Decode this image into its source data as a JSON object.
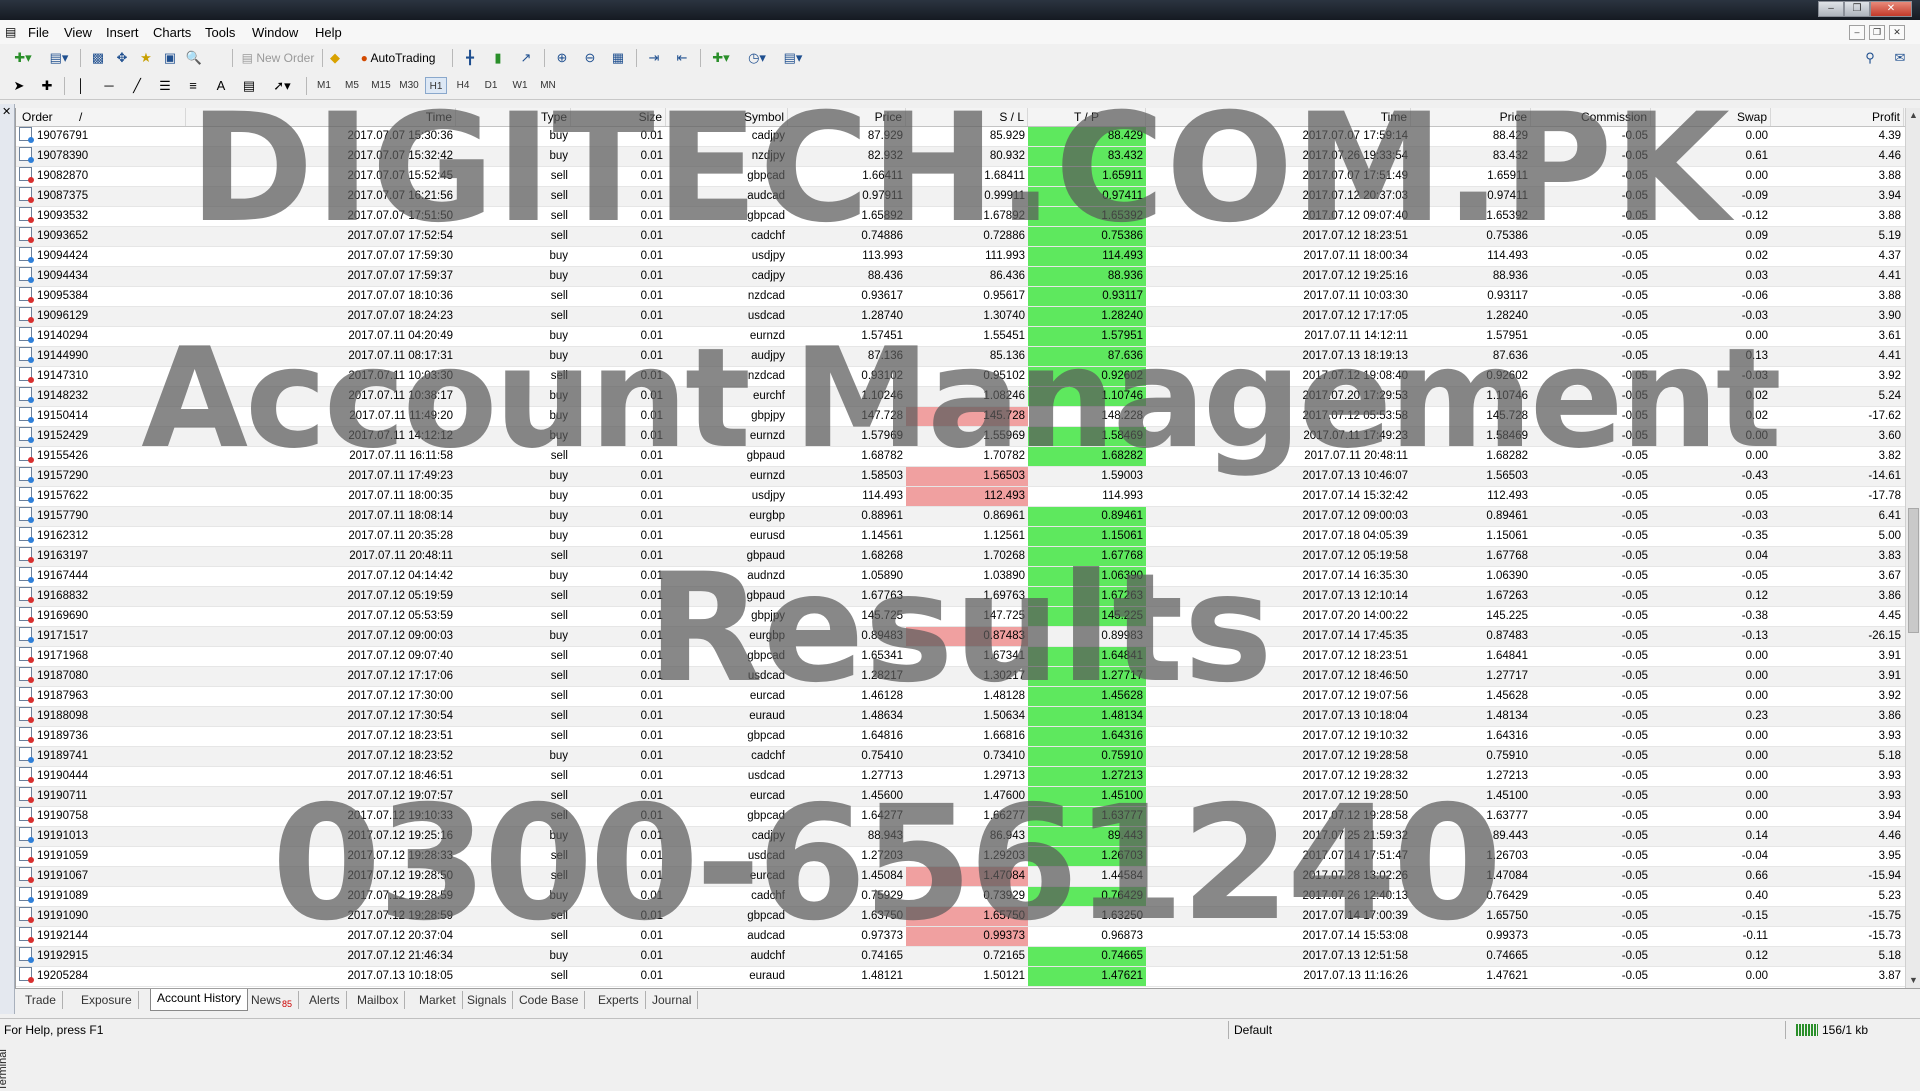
{
  "menu": [
    "File",
    "View",
    "Insert",
    "Charts",
    "Tools",
    "Window",
    "Help"
  ],
  "toolbar": {
    "new_order": "New Order",
    "autotrading": "AutoTrading"
  },
  "timeframes": [
    "M1",
    "M5",
    "M15",
    "M30",
    "H1",
    "H4",
    "D1",
    "W1",
    "MN"
  ],
  "active_timeframe": "H1",
  "table": {
    "headers": [
      "Order",
      "/",
      "Time",
      "Type",
      "Size",
      "Symbol",
      "Price",
      "S / L",
      "T / P",
      "Time",
      "Price",
      "Commission",
      "Swap",
      "Profit"
    ],
    "rows": [
      [
        "19076791",
        "2017.07.07 15:30:36",
        "buy",
        "0.01",
        "cadjpy",
        "87.929",
        "85.929",
        "88.429",
        "2017.07.07 17:59:14",
        "88.429",
        "-0.05",
        "0.00",
        "4.39",
        "tp"
      ],
      [
        "19078390",
        "2017.07.07 15:32:42",
        "buy",
        "0.01",
        "nzdjpy",
        "82.932",
        "80.932",
        "83.432",
        "2017.07.26 19:33:54",
        "83.432",
        "-0.05",
        "0.61",
        "4.46",
        "tp"
      ],
      [
        "19082870",
        "2017.07.07 15:52:45",
        "sell",
        "0.01",
        "gbpcad",
        "1.66411",
        "1.68411",
        "1.65911",
        "2017.07.07 17:51:49",
        "1.65911",
        "-0.05",
        "0.00",
        "3.88",
        "tp"
      ],
      [
        "19087375",
        "2017.07.07 16:21:56",
        "sell",
        "0.01",
        "audcad",
        "0.97911",
        "0.99911",
        "0.97411",
        "2017.07.12 20:37:03",
        "0.97411",
        "-0.05",
        "-0.09",
        "3.94",
        "tp"
      ],
      [
        "19093532",
        "2017.07.07 17:51:50",
        "sell",
        "0.01",
        "gbpcad",
        "1.65892",
        "1.67892",
        "1.65392",
        "2017.07.12 09:07:40",
        "1.65392",
        "-0.05",
        "-0.12",
        "3.88",
        "tp"
      ],
      [
        "19093652",
        "2017.07.07 17:52:54",
        "sell",
        "0.01",
        "cadchf",
        "0.74886",
        "0.72886",
        "0.75386",
        "2017.07.12 18:23:51",
        "0.75386",
        "-0.05",
        "0.09",
        "5.19",
        "tp"
      ],
      [
        "19094424",
        "2017.07.07 17:59:30",
        "buy",
        "0.01",
        "usdjpy",
        "113.993",
        "111.993",
        "114.493",
        "2017.07.11 18:00:34",
        "114.493",
        "-0.05",
        "0.02",
        "4.37",
        "tp"
      ],
      [
        "19094434",
        "2017.07.07 17:59:37",
        "buy",
        "0.01",
        "cadjpy",
        "88.436",
        "86.436",
        "88.936",
        "2017.07.12 19:25:16",
        "88.936",
        "-0.05",
        "0.03",
        "4.41",
        "tp"
      ],
      [
        "19095384",
        "2017.07.07 18:10:36",
        "sell",
        "0.01",
        "nzdcad",
        "0.93617",
        "0.95617",
        "0.93117",
        "2017.07.11 10:03:30",
        "0.93117",
        "-0.05",
        "-0.06",
        "3.88",
        "tp"
      ],
      [
        "19096129",
        "2017.07.07 18:24:23",
        "sell",
        "0.01",
        "usdcad",
        "1.28740",
        "1.30740",
        "1.28240",
        "2017.07.12 17:17:05",
        "1.28240",
        "-0.05",
        "-0.03",
        "3.90",
        "tp"
      ],
      [
        "19140294",
        "2017.07.11 04:20:49",
        "buy",
        "0.01",
        "eurnzd",
        "1.57451",
        "1.55451",
        "1.57951",
        "2017.07.11 14:12:11",
        "1.57951",
        "-0.05",
        "0.00",
        "3.61",
        "tp"
      ],
      [
        "19144990",
        "2017.07.11 08:17:31",
        "buy",
        "0.01",
        "audjpy",
        "87.136",
        "85.136",
        "87.636",
        "2017.07.13 18:19:13",
        "87.636",
        "-0.05",
        "0.13",
        "4.41",
        "tp"
      ],
      [
        "19147310",
        "2017.07.11 10:03:30",
        "sell",
        "0.01",
        "nzdcad",
        "0.93102",
        "0.95102",
        "0.92602",
        "2017.07.12 19:08:40",
        "0.92602",
        "-0.05",
        "-0.03",
        "3.92",
        "tp"
      ],
      [
        "19148232",
        "2017.07.11 10:38:17",
        "buy",
        "0.01",
        "eurchf",
        "1.10246",
        "1.08246",
        "1.10746",
        "2017.07.20 17:29:53",
        "1.10746",
        "-0.05",
        "0.02",
        "5.24",
        "tp"
      ],
      [
        "19150414",
        "2017.07.11 11:49:20",
        "buy",
        "0.01",
        "gbpjpy",
        "147.728",
        "145.728",
        "148.228",
        "2017.07.12 05:53:58",
        "145.728",
        "-0.05",
        "0.02",
        "-17.62",
        "sl"
      ],
      [
        "19152429",
        "2017.07.11 14:12:12",
        "buy",
        "0.01",
        "eurnzd",
        "1.57969",
        "1.55969",
        "1.58469",
        "2017.07.11 17:49:23",
        "1.58469",
        "-0.05",
        "0.00",
        "3.60",
        "tp"
      ],
      [
        "19155426",
        "2017.07.11 16:11:58",
        "sell",
        "0.01",
        "gbpaud",
        "1.68782",
        "1.70782",
        "1.68282",
        "2017.07.11 20:48:11",
        "1.68282",
        "-0.05",
        "0.00",
        "3.82",
        "tp"
      ],
      [
        "19157290",
        "2017.07.11 17:49:23",
        "buy",
        "0.01",
        "eurnzd",
        "1.58503",
        "1.56503",
        "1.59003",
        "2017.07.13 10:46:07",
        "1.56503",
        "-0.05",
        "-0.43",
        "-14.61",
        "sl"
      ],
      [
        "19157622",
        "2017.07.11 18:00:35",
        "buy",
        "0.01",
        "usdjpy",
        "114.493",
        "112.493",
        "114.993",
        "2017.07.14 15:32:42",
        "112.493",
        "-0.05",
        "0.05",
        "-17.78",
        "sl"
      ],
      [
        "19157790",
        "2017.07.11 18:08:14",
        "buy",
        "0.01",
        "eurgbp",
        "0.88961",
        "0.86961",
        "0.89461",
        "2017.07.12 09:00:03",
        "0.89461",
        "-0.05",
        "-0.03",
        "6.41",
        "tp"
      ],
      [
        "19162312",
        "2017.07.11 20:35:28",
        "buy",
        "0.01",
        "eurusd",
        "1.14561",
        "1.12561",
        "1.15061",
        "2017.07.18 04:05:39",
        "1.15061",
        "-0.05",
        "-0.35",
        "5.00",
        "tp"
      ],
      [
        "19163197",
        "2017.07.11 20:48:11",
        "sell",
        "0.01",
        "gbpaud",
        "1.68268",
        "1.70268",
        "1.67768",
        "2017.07.12 05:19:58",
        "1.67768",
        "-0.05",
        "0.04",
        "3.83",
        "tp"
      ],
      [
        "19167444",
        "2017.07.12 04:14:42",
        "buy",
        "0.01",
        "audnzd",
        "1.05890",
        "1.03890",
        "1.06390",
        "2017.07.14 16:35:30",
        "1.06390",
        "-0.05",
        "-0.05",
        "3.67",
        "tp"
      ],
      [
        "19168832",
        "2017.07.12 05:19:59",
        "sell",
        "0.01",
        "gbpaud",
        "1.67763",
        "1.69763",
        "1.67263",
        "2017.07.13 12:10:14",
        "1.67263",
        "-0.05",
        "0.12",
        "3.86",
        "tp"
      ],
      [
        "19169690",
        "2017.07.12 05:53:59",
        "sell",
        "0.01",
        "gbpjpy",
        "145.725",
        "147.725",
        "145.225",
        "2017.07.20 14:00:22",
        "145.225",
        "-0.05",
        "-0.38",
        "4.45",
        "tp"
      ],
      [
        "19171517",
        "2017.07.12 09:00:03",
        "buy",
        "0.01",
        "eurgbp",
        "0.89483",
        "0.87483",
        "0.89983",
        "2017.07.14 17:45:35",
        "0.87483",
        "-0.05",
        "-0.13",
        "-26.15",
        "sl"
      ],
      [
        "19171968",
        "2017.07.12 09:07:40",
        "sell",
        "0.01",
        "gbpcad",
        "1.65341",
        "1.67341",
        "1.64841",
        "2017.07.12 18:23:51",
        "1.64841",
        "-0.05",
        "0.00",
        "3.91",
        "tp"
      ],
      [
        "19187080",
        "2017.07.12 17:17:06",
        "sell",
        "0.01",
        "usdcad",
        "1.28217",
        "1.30217",
        "1.27717",
        "2017.07.12 18:46:50",
        "1.27717",
        "-0.05",
        "0.00",
        "3.91",
        "tp"
      ],
      [
        "19187963",
        "2017.07.12 17:30:00",
        "sell",
        "0.01",
        "eurcad",
        "1.46128",
        "1.48128",
        "1.45628",
        "2017.07.12 19:07:56",
        "1.45628",
        "-0.05",
        "0.00",
        "3.92",
        "tp"
      ],
      [
        "19188098",
        "2017.07.12 17:30:54",
        "sell",
        "0.01",
        "euraud",
        "1.48634",
        "1.50634",
        "1.48134",
        "2017.07.13 10:18:04",
        "1.48134",
        "-0.05",
        "0.23",
        "3.86",
        "tp"
      ],
      [
        "19189736",
        "2017.07.12 18:23:51",
        "sell",
        "0.01",
        "gbpcad",
        "1.64816",
        "1.66816",
        "1.64316",
        "2017.07.12 19:10:32",
        "1.64316",
        "-0.05",
        "0.00",
        "3.93",
        "tp"
      ],
      [
        "19189741",
        "2017.07.12 18:23:52",
        "buy",
        "0.01",
        "cadchf",
        "0.75410",
        "0.73410",
        "0.75910",
        "2017.07.12 19:28:58",
        "0.75910",
        "-0.05",
        "0.00",
        "5.18",
        "tp"
      ],
      [
        "19190444",
        "2017.07.12 18:46:51",
        "sell",
        "0.01",
        "usdcad",
        "1.27713",
        "1.29713",
        "1.27213",
        "2017.07.12 19:28:32",
        "1.27213",
        "-0.05",
        "0.00",
        "3.93",
        "tp"
      ],
      [
        "19190711",
        "2017.07.12 19:07:57",
        "sell",
        "0.01",
        "eurcad",
        "1.45600",
        "1.47600",
        "1.45100",
        "2017.07.12 19:28:50",
        "1.45100",
        "-0.05",
        "0.00",
        "3.93",
        "tp"
      ],
      [
        "19190758",
        "2017.07.12 19:10:33",
        "sell",
        "0.01",
        "gbpcad",
        "1.64277",
        "1.66277",
        "1.63777",
        "2017.07.12 19:28:58",
        "1.63777",
        "-0.05",
        "0.00",
        "3.94",
        "tp"
      ],
      [
        "19191013",
        "2017.07.12 19:25:16",
        "buy",
        "0.01",
        "cadjpy",
        "88.943",
        "86.943",
        "89.443",
        "2017.07.25 21:59:32",
        "89.443",
        "-0.05",
        "0.14",
        "4.46",
        "tp"
      ],
      [
        "19191059",
        "2017.07.12 19:28:33",
        "sell",
        "0.01",
        "usdcad",
        "1.27203",
        "1.29203",
        "1.26703",
        "2017.07.14 17:51:47",
        "1.26703",
        "-0.05",
        "-0.04",
        "3.95",
        "tp"
      ],
      [
        "19191067",
        "2017.07.12 19:28:50",
        "sell",
        "0.01",
        "eurcad",
        "1.45084",
        "1.47084",
        "1.44584",
        "2017.07.28 13:02:26",
        "1.47084",
        "-0.05",
        "0.66",
        "-15.94",
        "sl"
      ],
      [
        "19191089",
        "2017.07.12 19:28:59",
        "buy",
        "0.01",
        "cadchf",
        "0.75929",
        "0.73929",
        "0.76429",
        "2017.07.26 12:40:13",
        "0.76429",
        "-0.05",
        "0.40",
        "5.23",
        "tp"
      ],
      [
        "19191090",
        "2017.07.12 19:28:59",
        "sell",
        "0.01",
        "gbpcad",
        "1.63750",
        "1.65750",
        "1.63250",
        "2017.07.14 17:00:39",
        "1.65750",
        "-0.05",
        "-0.15",
        "-15.75",
        "sl"
      ],
      [
        "19192144",
        "2017.07.12 20:37:04",
        "sell",
        "0.01",
        "audcad",
        "0.97373",
        "0.99373",
        "0.96873",
        "2017.07.14 15:53:08",
        "0.99373",
        "-0.05",
        "-0.11",
        "-15.73",
        "sl"
      ],
      [
        "19192915",
        "2017.07.12 21:46:34",
        "buy",
        "0.01",
        "audchf",
        "0.74165",
        "0.72165",
        "0.74665",
        "2017.07.13 12:51:58",
        "0.74665",
        "-0.05",
        "0.12",
        "5.18",
        "tp"
      ],
      [
        "19205284",
        "2017.07.13 10:18:05",
        "sell",
        "0.01",
        "euraud",
        "1.48121",
        "1.50121",
        "1.47621",
        "2017.07.13 11:16:26",
        "1.47621",
        "-0.05",
        "0.00",
        "3.87",
        "tp"
      ]
    ]
  },
  "tabs": [
    {
      "label": "Trade",
      "badge": ""
    },
    {
      "label": "Exposure",
      "badge": ""
    },
    {
      "label": "Account History",
      "badge": ""
    },
    {
      "label": "News",
      "badge": "85"
    },
    {
      "label": "Alerts",
      "badge": ""
    },
    {
      "label": "Mailbox",
      "badge": ""
    },
    {
      "label": "Market",
      "badge": ""
    },
    {
      "label": "Signals",
      "badge": ""
    },
    {
      "label": "Code Base",
      "badge": ""
    },
    {
      "label": "Experts",
      "badge": ""
    },
    {
      "label": "Journal",
      "badge": ""
    }
  ],
  "active_tab": "Account History",
  "side_label": "Terminal",
  "status": {
    "help": "For Help, press F1",
    "profile": "Default",
    "connection": "156/1 kb"
  },
  "watermark": {
    "line1": "DIGITECH.COM.PK",
    "line2": "Account Management",
    "line3": "Results",
    "line4": "0300-6561240"
  },
  "colors": {
    "tp_hit": "#5ee85e",
    "sl_hit": "#f0a0a0"
  }
}
